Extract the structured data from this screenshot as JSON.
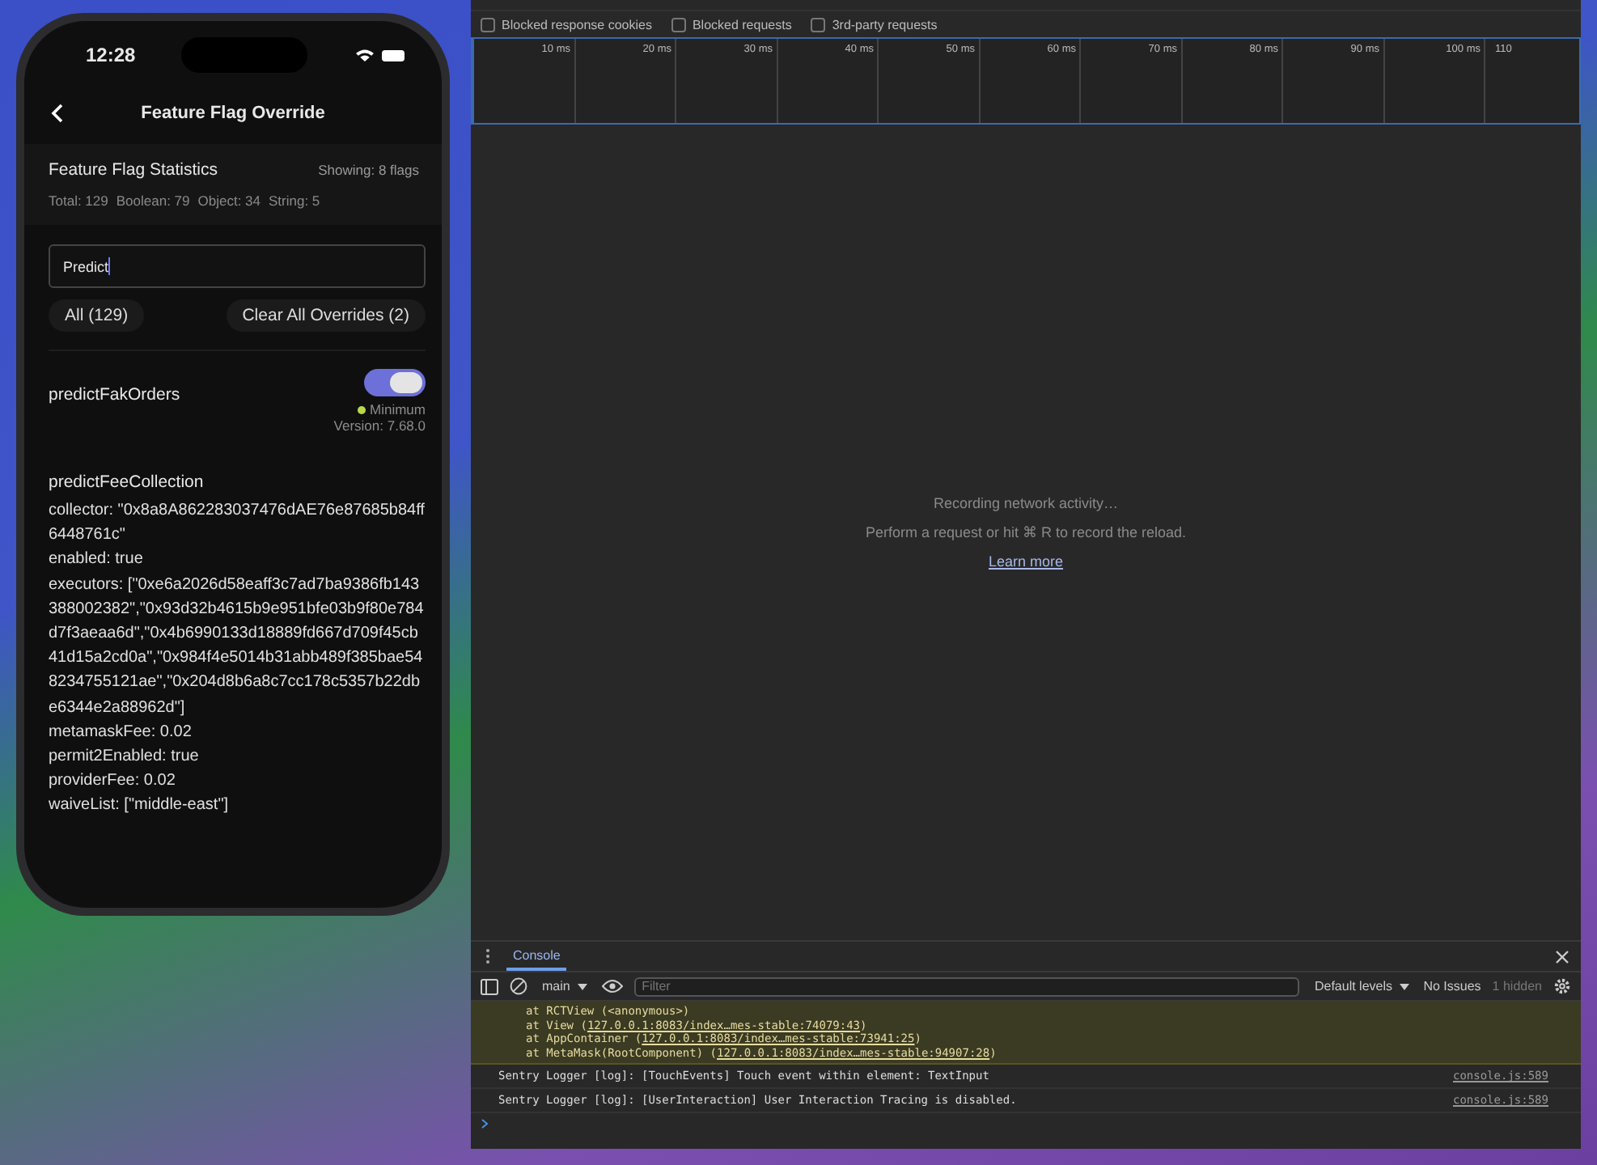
{
  "phone": {
    "time": "12:28",
    "title": "Feature Flag Override",
    "stats": {
      "title": "Feature Flag Statistics",
      "showing": "Showing: 8 flags",
      "counts": [
        "Total: 129",
        "Boolean: 79",
        "Object: 34",
        "String: 5"
      ]
    },
    "search": {
      "value": "Predict"
    },
    "filter_buttons": [
      "All (129)",
      "Clear All Overrides (2)"
    ],
    "flags": [
      {
        "kind": "toggle",
        "name": "predictFakOrders",
        "on": true,
        "requirement": "Minimum",
        "version": "Version: 7.68.0"
      },
      {
        "kind": "object",
        "name": "predictFeeCollection",
        "lines": [
          "collector: \"0x8a8A862283037476dAE76e87685b84ff6448761c\"",
          "enabled: true",
          "executors: [\"0xe6a2026d58eaff3c7ad7ba9386fb143388002382\",\"0x93d32b4615b9e951bfe03b9f80e784d7f3aeaa6d\",\"0x4b6990133d18889fd667d709f45cb41d15a2cd0a\",\"0x984f4e5014b31abb489f385bae548234755121ae\",\"0x204d8b6a8c7cc178c5357b22dbe6344e2a88962d\"]",
          "metamaskFee: 0.02",
          "permit2Enabled: true",
          "providerFee: 0.02",
          "waiveList: [\"middle-east\"]"
        ]
      }
    ]
  },
  "devtools": {
    "filters": [
      {
        "label": "Blocked response cookies",
        "checked": false
      },
      {
        "label": "Blocked requests",
        "checked": false
      },
      {
        "label": "3rd-party requests",
        "checked": false
      }
    ],
    "timeline_ticks": [
      "10 ms",
      "20 ms",
      "30 ms",
      "40 ms",
      "50 ms",
      "60 ms",
      "70 ms",
      "80 ms",
      "90 ms",
      "100 ms",
      "110"
    ],
    "empty_state": {
      "title": "Recording network activity…",
      "hint": "Perform a request or hit ⌘ R to record the reload.",
      "link": "Learn more"
    },
    "drawer": {
      "tab": "Console",
      "context": "main",
      "filter_placeholder": "Filter",
      "levels": "Default levels",
      "issues": "No Issues",
      "hidden": "1 hidden",
      "warning_lines": [
        {
          "prefix": "at RCTView (<anonymous>)"
        },
        {
          "prefix": "at View (",
          "link": "127.0.0.1:8083/index…mes-stable:74079:43",
          "suffix": ")"
        },
        {
          "prefix": "at AppContainer (",
          "link": "127.0.0.1:8083/index…mes-stable:73941:25",
          "suffix": ")"
        },
        {
          "prefix": "at MetaMask(RootComponent) (",
          "link": "127.0.0.1:8083/index…mes-stable:94907:28",
          "suffix": ")"
        }
      ],
      "logs": [
        {
          "text": "Sentry Logger [log]: [TouchEvents] Touch event within element: TextInput",
          "source": "console.js:589"
        },
        {
          "text": "Sentry Logger [log]: [UserInteraction] User Interaction Tracing is disabled.",
          "source": "console.js:589"
        }
      ]
    }
  }
}
